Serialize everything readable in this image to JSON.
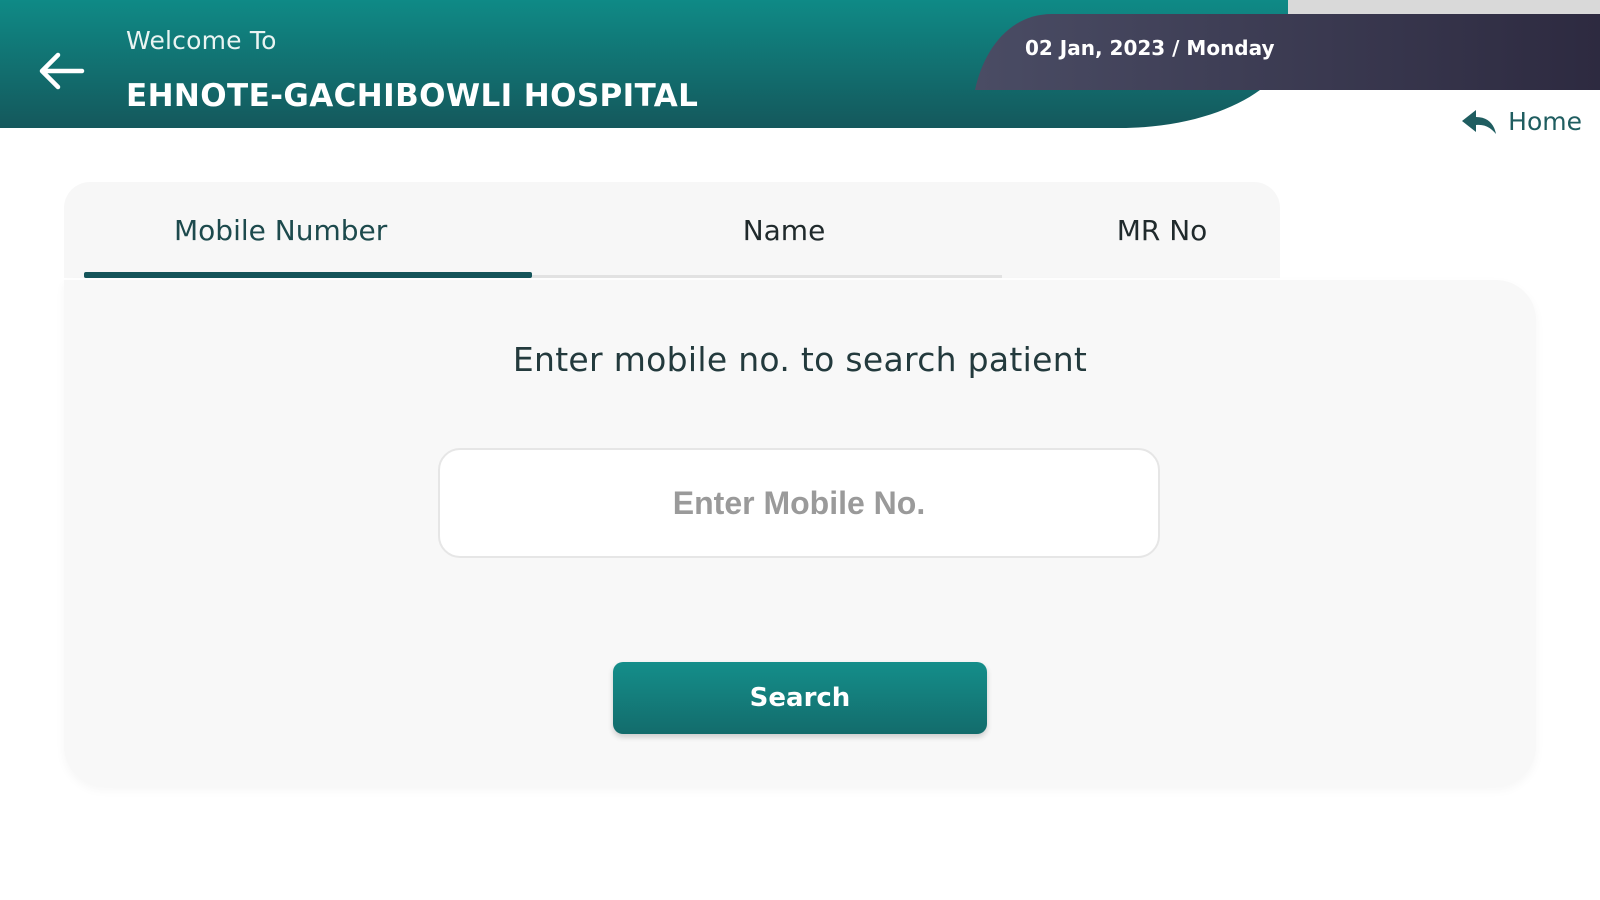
{
  "header": {
    "welcome_text": "Welcome To",
    "hospital_name": "EHNOTE-GACHIBOWLI HOSPITAL",
    "date_text": "02 Jan, 2023 / Monday",
    "back_icon": "arrow-left-icon",
    "home_label": "Home",
    "home_icon": "reply-arrow-icon"
  },
  "tabs": [
    {
      "label": "Mobile Number",
      "active": true
    },
    {
      "label": "Name",
      "active": false
    },
    {
      "label": "MR No",
      "active": false
    }
  ],
  "search": {
    "prompt": "Enter mobile no. to search patient",
    "input_value": "",
    "placeholder": "Enter Mobile No.",
    "button_label": "Search"
  },
  "colors": {
    "header_teal": "#0f8582",
    "header_dark_teal": "#14585c",
    "date_band": "#332f45",
    "accent": "#15555a",
    "button": "#147c7a"
  }
}
